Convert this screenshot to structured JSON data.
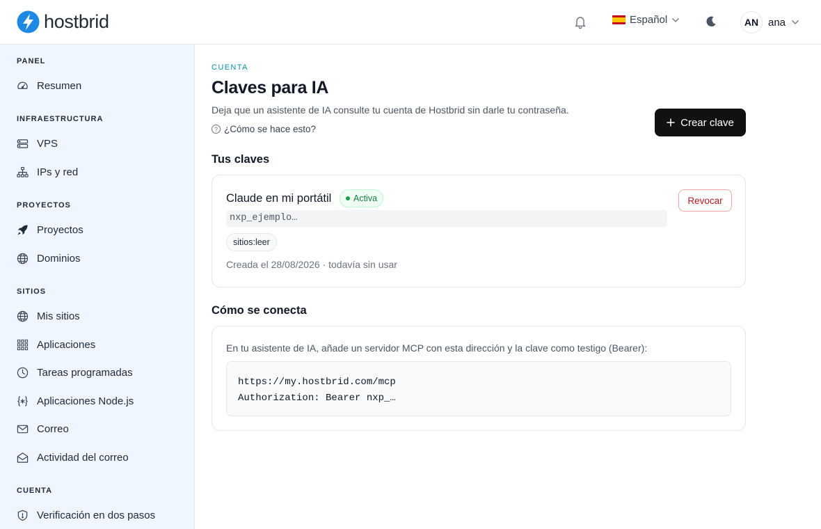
{
  "header": {
    "brand": "hostbrid",
    "language": "Español",
    "user_initials": "AN",
    "user_name": "ana"
  },
  "sidebar": {
    "sections": [
      {
        "label": "PANEL",
        "items": [
          {
            "label": "Resumen",
            "icon": "gauge-icon"
          }
        ]
      },
      {
        "label": "INFRAESTRUCTURA",
        "items": [
          {
            "label": "VPS",
            "icon": "server-icon"
          },
          {
            "label": "IPs y red",
            "icon": "network-icon"
          }
        ]
      },
      {
        "label": "PROYECTOS",
        "items": [
          {
            "label": "Proyectos",
            "icon": "rocket-icon"
          },
          {
            "label": "Dominios",
            "icon": "globe-icon"
          }
        ]
      },
      {
        "label": "SITIOS",
        "items": [
          {
            "label": "Mis sitios",
            "icon": "globe-icon"
          },
          {
            "label": "Aplicaciones",
            "icon": "grid-icon"
          },
          {
            "label": "Tareas programadas",
            "icon": "clock-icon"
          },
          {
            "label": "Aplicaciones Node.js",
            "icon": "braces-icon"
          },
          {
            "label": "Correo",
            "icon": "mail-icon"
          },
          {
            "label": "Actividad del correo",
            "icon": "mail-open-icon"
          }
        ]
      },
      {
        "label": "CUENTA",
        "items": [
          {
            "label": "Verificación en dos pasos",
            "icon": "shield-icon"
          }
        ]
      }
    ]
  },
  "page": {
    "eyebrow": "CUENTA",
    "title": "Claves para IA",
    "description": "Deja que un asistente de IA consulte tu cuenta de Hostbrid sin darle tu contraseña.",
    "help_link": "¿Cómo se hace esto?",
    "create_button": "Crear clave"
  },
  "keys_section": {
    "heading": "Tus claves",
    "keys": [
      {
        "name": "Claude en mi portátil",
        "status": "Activa",
        "prefix": "nxp_ejemplo…",
        "scope": "sitios:leer",
        "meta": "Creada el 28/08/2026 · todavía sin usar",
        "revoke_label": "Revocar"
      }
    ]
  },
  "connect_section": {
    "heading": "Cómo se conecta",
    "instructions": "En tu asistente de IA, añade un servidor MCP con esta dirección y la clave como testigo (Bearer):",
    "code_lines": [
      "https://my.hostbrid.com/mcp",
      "Authorization: Bearer nxp_…"
    ]
  },
  "colors": {
    "sidebar_bg": "#eff6ff",
    "accent": "#0891b2",
    "primary_button": "#111111",
    "active_green": "#15803d",
    "danger": "#b91c1c"
  }
}
